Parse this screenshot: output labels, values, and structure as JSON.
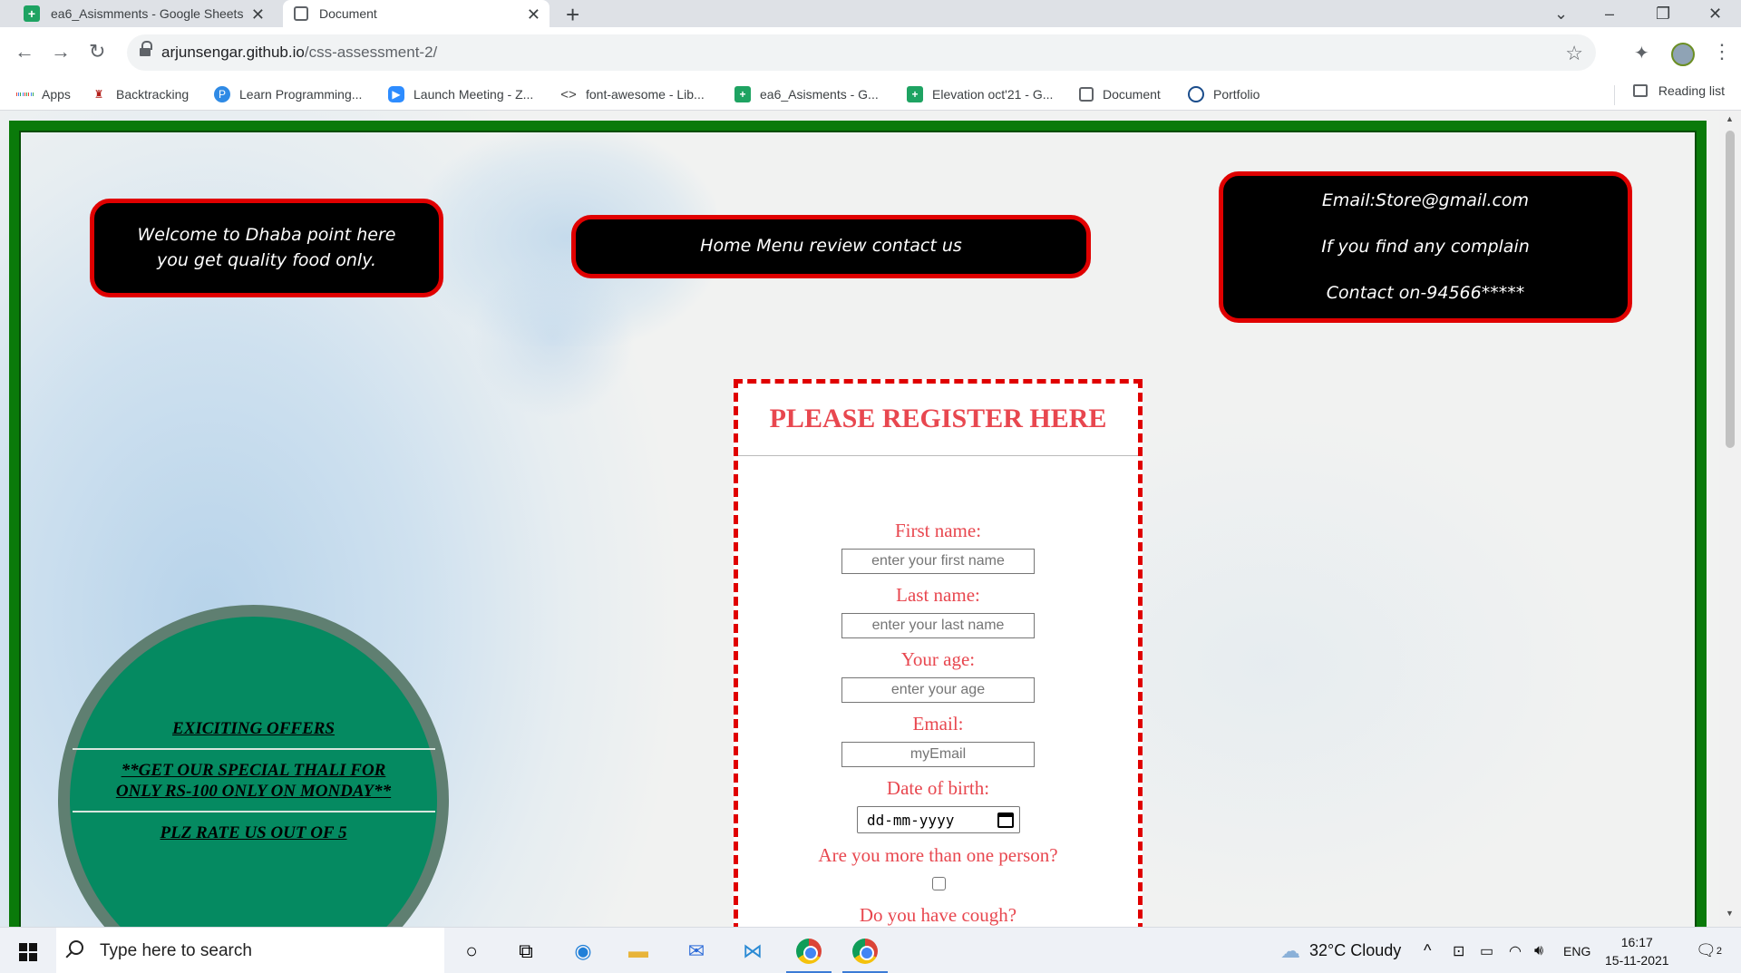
{
  "browser": {
    "tabs": [
      {
        "title": "ea6_Asismments - Google Sheets",
        "icon": "sheets-icon"
      },
      {
        "title": "Document",
        "icon": "globe-icon",
        "active": true
      }
    ],
    "new_tab": "+",
    "url_host": "arjunsengar.github.io",
    "url_path": "/css-assessment-2/",
    "bookmarks": [
      {
        "label": "Apps",
        "icon": "apps-icon"
      },
      {
        "label": "Backtracking",
        "icon": "backtracking-icon"
      },
      {
        "label": "Learn Programming...",
        "icon": "learn-programming-icon"
      },
      {
        "label": "Launch Meeting - Z...",
        "icon": "zoom-icon"
      },
      {
        "label": "font-awesome - Lib...",
        "icon": "code-icon"
      },
      {
        "label": "ea6_Asisments - G...",
        "icon": "sheets-icon"
      },
      {
        "label": "Elevation oct'21 - G...",
        "icon": "sheets-icon"
      },
      {
        "label": "Document",
        "icon": "globe-icon"
      },
      {
        "label": "Portfolio",
        "icon": "portfolio-icon"
      }
    ],
    "reading_list": "Reading list"
  },
  "page": {
    "welcome_line1": "Welcome to Dhaba point here",
    "welcome_line2": "you get quality food only.",
    "nav_links": [
      "Home",
      "Menu",
      "review",
      "contact us"
    ],
    "contact_email": "Email:Store@gmail.com",
    "contact_complain": "If you find any complain",
    "contact_phone": "Contact on-94566*****",
    "register": {
      "title": "PLEASE REGISTER HERE",
      "first_name_label": "First name:",
      "first_name_placeholder": "enter your first name",
      "last_name_label": "Last name:",
      "last_name_placeholder": "enter your last name",
      "age_label": "Your age:",
      "age_placeholder": "enter your age",
      "email_label": "Email:",
      "email_placeholder": "myEmail",
      "dob_label": "Date of birth:",
      "dob_placeholder": "dd-mm-yyyy",
      "more_than_one_label": "Are you more than one person?",
      "cough_label": "Do you have cough?"
    },
    "offers": {
      "line1": "EXICITING OFFERS",
      "line2a": "**GET OUR SPECIAL THALI FOR",
      "line2b": "ONLY RS-100 ONLY ON MONDAY**",
      "line3": "PLZ RATE US OUT OF 5"
    }
  },
  "taskbar": {
    "search_placeholder": "Type here to search",
    "weather": "32°C  Cloudy",
    "language": "ENG",
    "time": "16:17",
    "date": "15-11-2021",
    "notification_count": "2"
  },
  "colors": {
    "frame_green": "#0a7a0a",
    "box_red": "#e00000",
    "label_red": "#e8474f",
    "offers_green": "#058a61"
  }
}
